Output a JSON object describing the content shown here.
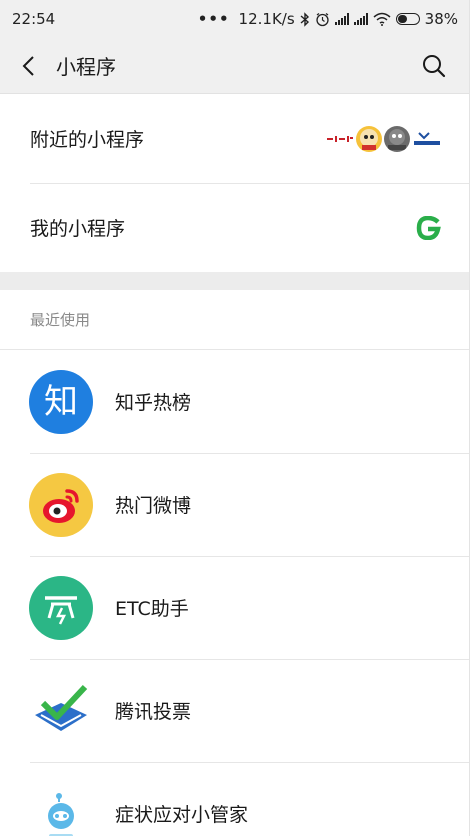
{
  "status_bar": {
    "time": "22:54",
    "speed": "12.1K/s",
    "battery": "38%",
    "icons": [
      "more-dots-icon",
      "bluetooth-icon",
      "alarm-icon",
      "signal-icon",
      "signal-icon",
      "wifi-icon",
      "battery-icon"
    ]
  },
  "header": {
    "title": "小程序",
    "back_icon": "chevron-left-icon",
    "search_icon": "search-icon"
  },
  "menu": {
    "nearby": {
      "label": "附近的小程序",
      "logos": [
        "nearby-logo-1",
        "nearby-logo-2",
        "nearby-logo-3",
        "nearby-logo-4"
      ]
    },
    "mine": {
      "label": "我的小程序",
      "icon": "g-logo-icon",
      "accent": "#2aae4a"
    }
  },
  "recent": {
    "title": "最近使用",
    "items": [
      {
        "name": "知乎热榜",
        "icon": "zhihu-icon",
        "glyph": "知",
        "color": "#1f7fe0"
      },
      {
        "name": "热门微博",
        "icon": "weibo-icon",
        "color": "#f5c842"
      },
      {
        "name": "ETC助手",
        "icon": "etc-icon",
        "color": "#2bb686"
      },
      {
        "name": "腾讯投票",
        "icon": "vote-check-icon",
        "color": "#39b54a"
      },
      {
        "name": "症状应对小管家",
        "icon": "robot-icon",
        "color": "#5bb8e8"
      }
    ]
  }
}
